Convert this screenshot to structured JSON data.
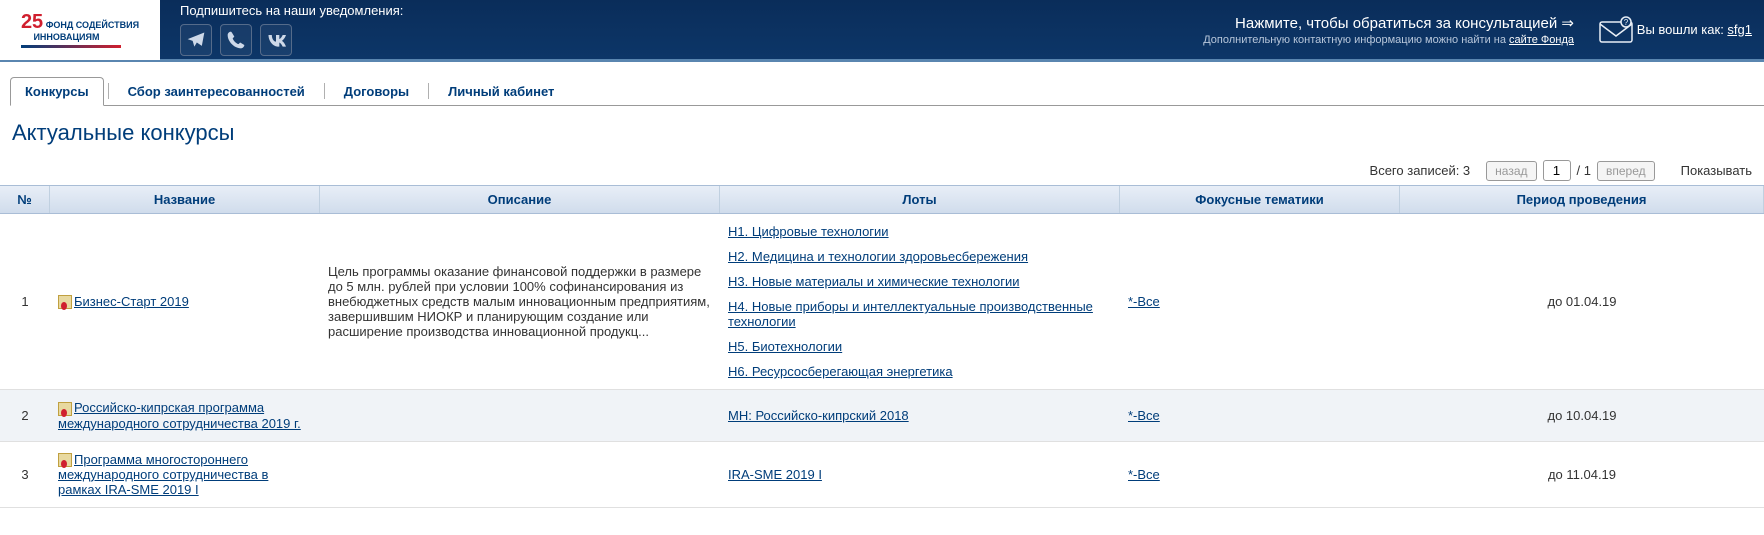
{
  "header": {
    "subscribe_label": "Подпишитесь на наши уведомления:",
    "consult_line1": "Нажмите, чтобы обратиться за консультацией ⇒",
    "consult_line2_pre": "Дополнительную контактную информацию можно найти на ",
    "consult_line2_link": "сайте Фонда",
    "login_pre": "Вы вошли как: ",
    "login_user": "sfg1"
  },
  "tabs": {
    "t1": "Конкурсы",
    "t2": "Сбор заинтересованностей",
    "t3": "Договоры",
    "t4": "Личный кабинет"
  },
  "page_title": "Актуальные конкурсы",
  "pager": {
    "total_label": "Всего записей: 3",
    "prev": "назад",
    "page": "1",
    "of": " / 1 ",
    "next": "вперед",
    "show": "Показывать"
  },
  "columns": {
    "num": "№",
    "name": "Название",
    "desc": "Описание",
    "lots": "Лоты",
    "focus": "Фокусные тематики",
    "period": "Период проведения"
  },
  "rows": [
    {
      "num": "1",
      "name": "Бизнес-Старт 2019",
      "desc": "Цель программы оказание финансовой поддержки в размере до 5 млн. рублей при условии 100% софинансирования из внебюджетных средств малым инновационным предприятиям, завершившим НИОКР и планирующим создание или расширение производства инновационной продукц...",
      "lots": [
        "Н1. Цифровые технологии",
        "Н2. Медицина и технологии здоровьесбережения",
        "Н3. Новые материалы и химические технологии",
        "Н4. Новые приборы и интеллектуальные производственные технологии",
        "Н5. Биотехнологии",
        "Н6. Ресурсосберегающая энергетика"
      ],
      "focus": "*-Все",
      "period": "до 01.04.19"
    },
    {
      "num": "2",
      "name": "Российско-кипрская программа международного сотрудничества 2019 г.",
      "desc": "",
      "lots": [
        "МН: Российско-кипрский 2018"
      ],
      "focus": "*-Все",
      "period": "до 10.04.19"
    },
    {
      "num": "3",
      "name": "Программа многостороннего международного сотрудничества в рамках IRA-SME 2019 I",
      "desc": "",
      "lots": [
        "IRA-SME 2019 I"
      ],
      "focus": "*-Все",
      "period": "до 11.04.19"
    }
  ]
}
